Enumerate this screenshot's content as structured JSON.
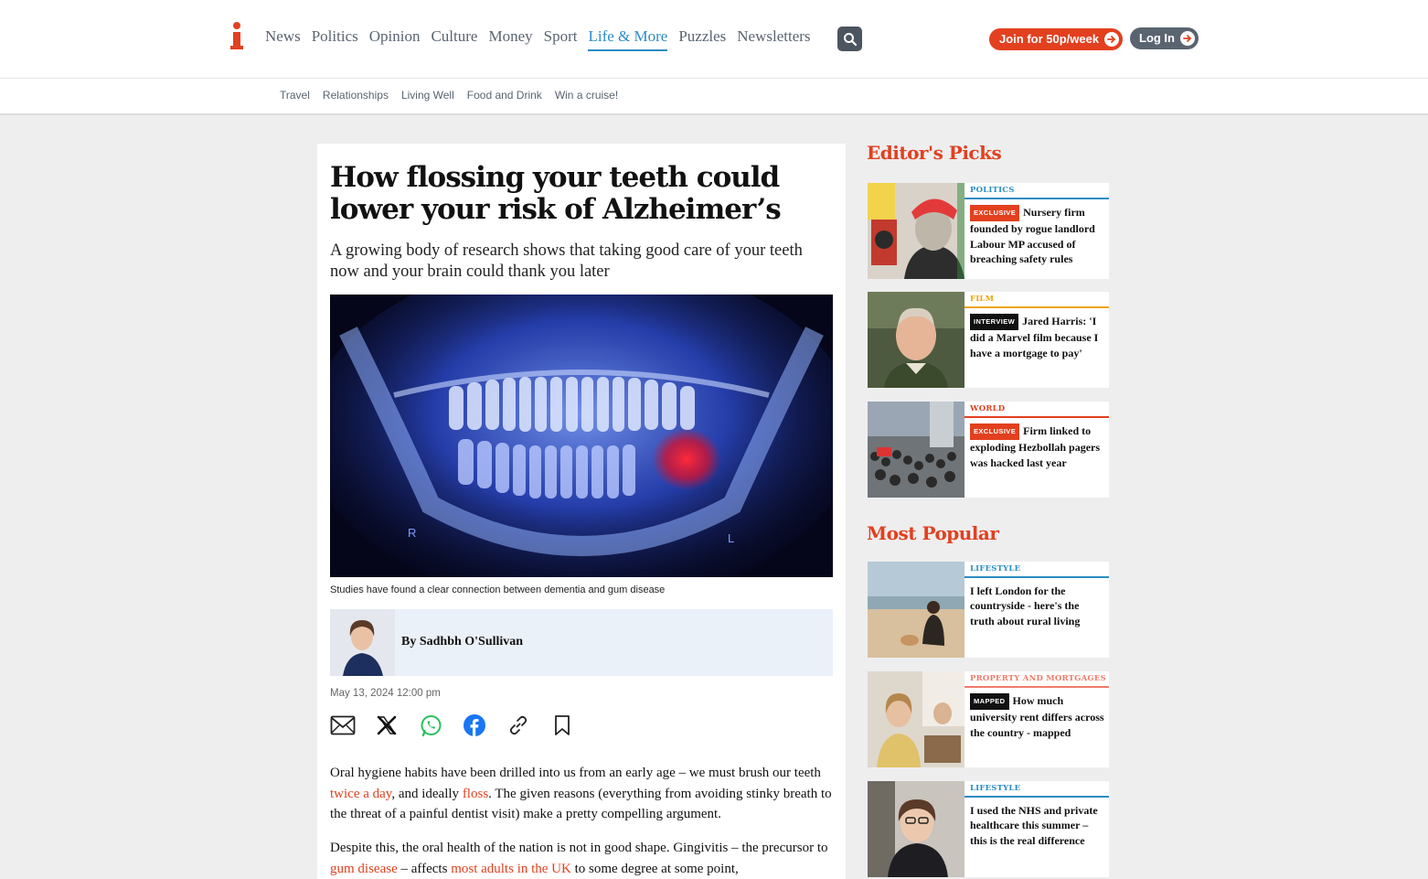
{
  "header": {
    "nav": [
      "News",
      "Politics",
      "Opinion",
      "Culture",
      "Money",
      "Sport",
      "Life & More",
      "Puzzles",
      "Newsletters"
    ],
    "active_nav": "Life & More",
    "join_label": "Join for 50p/week",
    "login_label": "Log In"
  },
  "subnav": [
    "Travel",
    "Relationships",
    "Living Well",
    "Food and Drink",
    "Win a cruise!"
  ],
  "article": {
    "headline": "How flossing your teeth could lower your risk of Alzheimer’s",
    "standfirst": "A growing body of research shows that taking good care of your teeth now and your brain could thank you later",
    "xray_left": "R",
    "xray_right": "L",
    "caption": "Studies have found a clear connection between dementia and gum disease",
    "author": "By Sadhbh O'Sullivan",
    "date": "May 13, 2024 12:00 pm",
    "p1": {
      "a": "Oral hygiene habits have been drilled into us from an early age – we must brush our teeth ",
      "link1": "twice a day",
      "b": ", and ideally ",
      "link2": "floss",
      "c": ". The given reasons (everything from avoiding stinky breath to the threat of a painful dentist visit) make a pretty compelling argument."
    },
    "p2": {
      "a": "Despite this, the oral health of the nation is not in good shape. Gingivitis – the precursor to ",
      "link1": "gum disease",
      "b": " – affects ",
      "link2": "most adults in the UK",
      "c": " to some degree at some point,"
    }
  },
  "sidebar": {
    "editors_picks_title": "Editor's Picks",
    "editors_picks": [
      {
        "section": "POLITICS",
        "section_color": "#2b8cc4",
        "tag": "EXCLUSIVE",
        "tag_style": "red",
        "title": "Nursery firm founded by rogue landlord Labour MP accused of breaching safety rules"
      },
      {
        "section": "FILM",
        "section_color": "#f0a30a",
        "tag": "INTERVIEW",
        "tag_style": "black",
        "title": "Jared Harris: 'I did a Marvel film because I have a mortgage to pay'"
      },
      {
        "section": "WORLD",
        "section_color": "#e2401f",
        "tag": "EXCLUSIVE",
        "tag_style": "red",
        "title": "Firm linked to exploding Hezbollah pagers was hacked last year"
      }
    ],
    "most_popular_title": "Most Popular",
    "most_popular": [
      {
        "section": "LIFESTYLE",
        "section_color": "#2b8cc4",
        "tag": "",
        "tag_style": "",
        "title": "I left London for the countryside - here's the truth about rural living"
      },
      {
        "section": "PROPERTY AND MORTGAGES",
        "section_color": "#f07a6a",
        "tag": "MAPPED",
        "tag_style": "black",
        "title": "How much university rent differs across the country - mapped"
      },
      {
        "section": "LIFESTYLE",
        "section_color": "#2b8cc4",
        "tag": "",
        "tag_style": "",
        "title": "I used the NHS and private healthcare this summer – this is the real difference"
      }
    ]
  },
  "colors": {
    "brand": "#e2401f",
    "link_blue": "#2b8cc4",
    "byline_bg": "#eaf1f9"
  }
}
